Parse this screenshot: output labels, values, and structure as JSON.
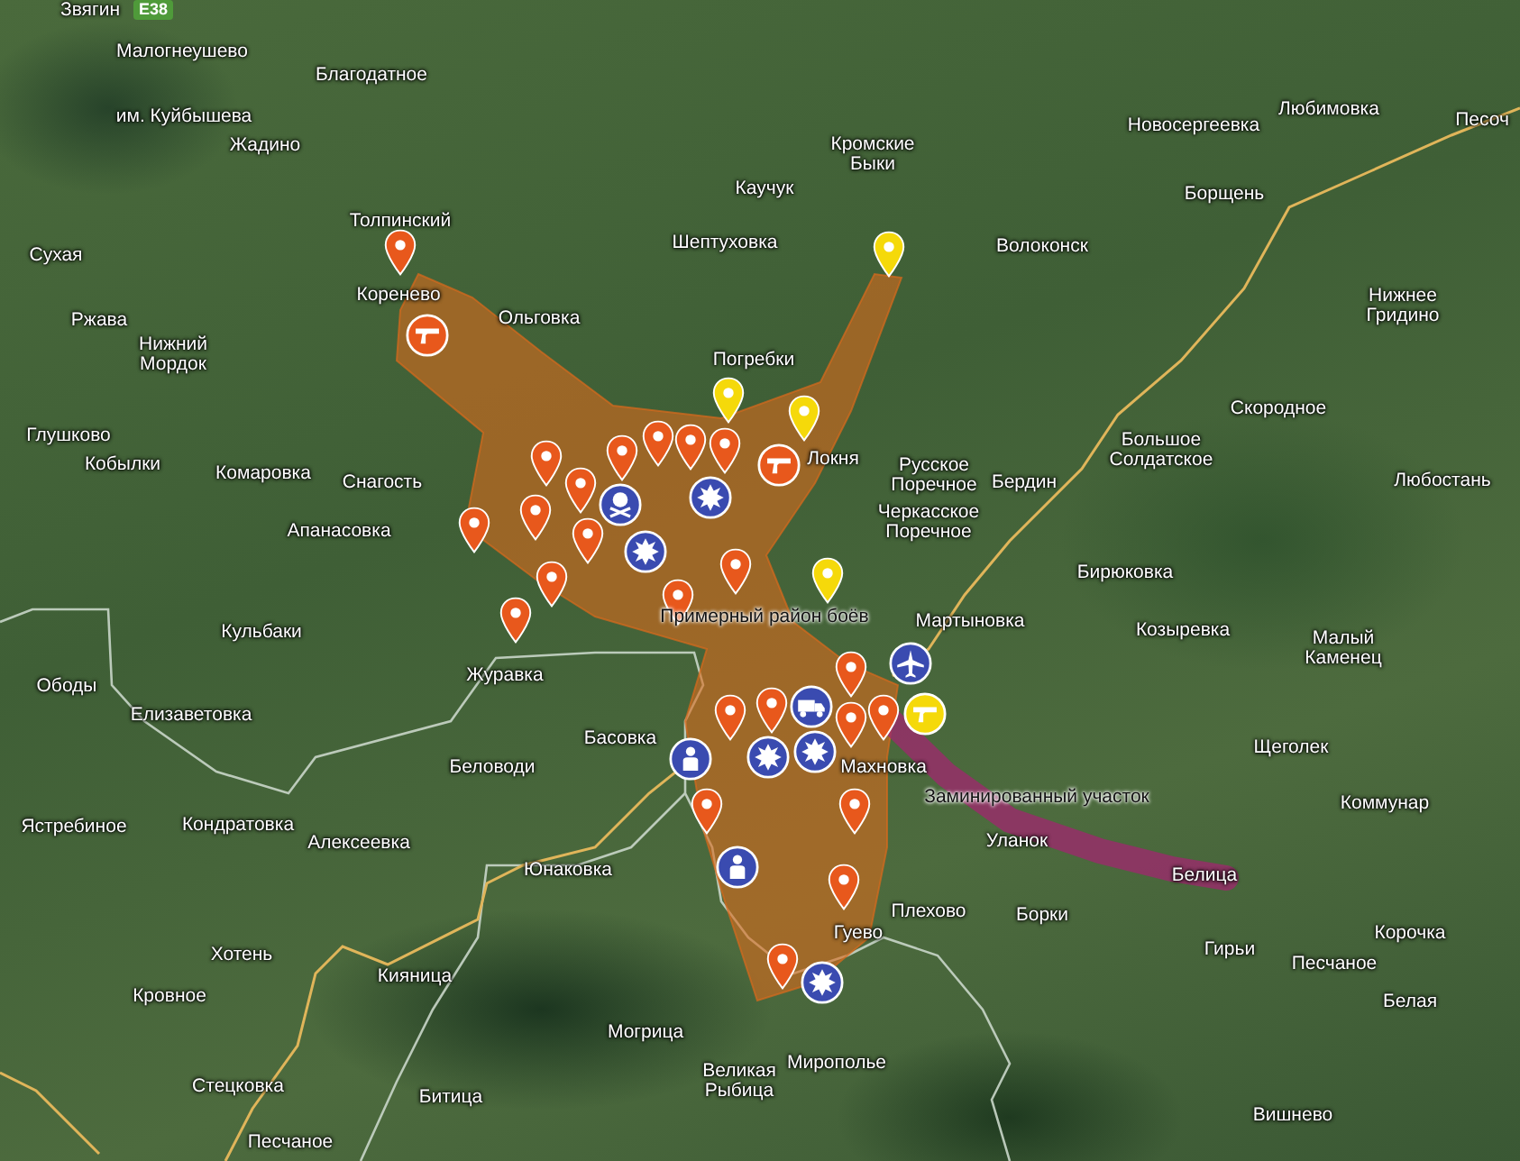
{
  "map": {
    "road_shield": "E38",
    "places": [
      "Звягин",
      "Малогнеушево",
      "Благодатное",
      "им. Куйбышева",
      "Жадино",
      "Толпинский",
      "Сухая",
      "Коренево",
      "Ржава",
      "Ольговка",
      "Нижний Мордок",
      "Кромские Быки",
      "Каучук",
      "Шептуховка",
      "Волоконск",
      "Новосергеевка",
      "Любимовка",
      "Борщень",
      "Песоч",
      "Нижнее Гридино",
      "Погребки",
      "Глушково",
      "Кобылки",
      "Комаровка",
      "Снагость",
      "Апанасовка",
      "Локня",
      "Русское Поречное",
      "Бердин",
      "Черкасское Поречное",
      "Большое Солдатское",
      "Скородное",
      "Любостань",
      "Бирюковка",
      "Кульбаки",
      "Мартыновка",
      "Козыревка",
      "Малый Каменец",
      "Журавка",
      "Ободы",
      "Елизаветовка",
      "Басовка",
      "Щеголек",
      "Беловоди",
      "Махновка",
      "Коммунар",
      "Ястребиное",
      "Кондратовка",
      "Алексеевка",
      "Уланок",
      "Юнаковка",
      "Белица",
      "Плехово",
      "Борки",
      "Гуево",
      "Корочка",
      "Гирьи",
      "Хотень",
      "Песчаное",
      "Кияница",
      "Кровное",
      "Белая",
      "Могрица",
      "Мирополье",
      "Стецковка",
      "Битица",
      "Великая Рыбица",
      "Вишнево",
      "Песчаное"
    ],
    "area_labels": [
      "Примерный район боёв",
      "Заминированный участок"
    ],
    "markers": [
      {
        "kind": "pin",
        "color": "#e8581c"
      },
      {
        "kind": "gun",
        "color": "#e8581c"
      },
      {
        "kind": "pin",
        "color": "#f5d90a"
      },
      {
        "kind": "pin",
        "color": "#f5d90a"
      },
      {
        "kind": "pin",
        "color": "#f5d90a"
      },
      {
        "kind": "pin",
        "color": "#e8581c"
      },
      {
        "kind": "pin",
        "color": "#e8581c"
      },
      {
        "kind": "pin",
        "color": "#e8581c"
      },
      {
        "kind": "pin",
        "color": "#e8581c"
      },
      {
        "kind": "pin",
        "color": "#e8581c"
      },
      {
        "kind": "pin",
        "color": "#e8581c"
      },
      {
        "kind": "pin",
        "color": "#e8581c"
      },
      {
        "kind": "pin",
        "color": "#e8581c"
      },
      {
        "kind": "pin",
        "color": "#e8581c"
      },
      {
        "kind": "pin",
        "color": "#e8581c"
      },
      {
        "kind": "pin",
        "color": "#e8581c"
      },
      {
        "kind": "pin",
        "color": "#e8581c"
      },
      {
        "kind": "pin",
        "color": "#e8581c"
      },
      {
        "kind": "skull",
        "color": "#3a4bb0"
      },
      {
        "kind": "explosion",
        "color": "#3a4bb0"
      },
      {
        "kind": "explosion",
        "color": "#3a4bb0"
      },
      {
        "kind": "gun",
        "color": "#e8581c"
      },
      {
        "kind": "pin",
        "color": "#f5d90a"
      },
      {
        "kind": "pin",
        "color": "#e8581c"
      },
      {
        "kind": "pin",
        "color": "#e8581c"
      },
      {
        "kind": "pin",
        "color": "#e8581c"
      },
      {
        "kind": "pin",
        "color": "#e8581c"
      },
      {
        "kind": "pin",
        "color": "#e8581c"
      },
      {
        "kind": "truck",
        "color": "#3a4bb0"
      },
      {
        "kind": "plane",
        "color": "#3a4bb0"
      },
      {
        "kind": "gun",
        "color": "#f5d90a"
      },
      {
        "kind": "explosion",
        "color": "#3a4bb0"
      },
      {
        "kind": "explosion",
        "color": "#3a4bb0"
      },
      {
        "kind": "person",
        "color": "#3a4bb0"
      },
      {
        "kind": "pin",
        "color": "#e8581c"
      },
      {
        "kind": "person",
        "color": "#3a4bb0"
      },
      {
        "kind": "pin",
        "color": "#e8581c"
      },
      {
        "kind": "pin",
        "color": "#e8581c"
      },
      {
        "kind": "pin",
        "color": "#e8581c"
      },
      {
        "kind": "explosion",
        "color": "#3a4bb0"
      }
    ]
  }
}
